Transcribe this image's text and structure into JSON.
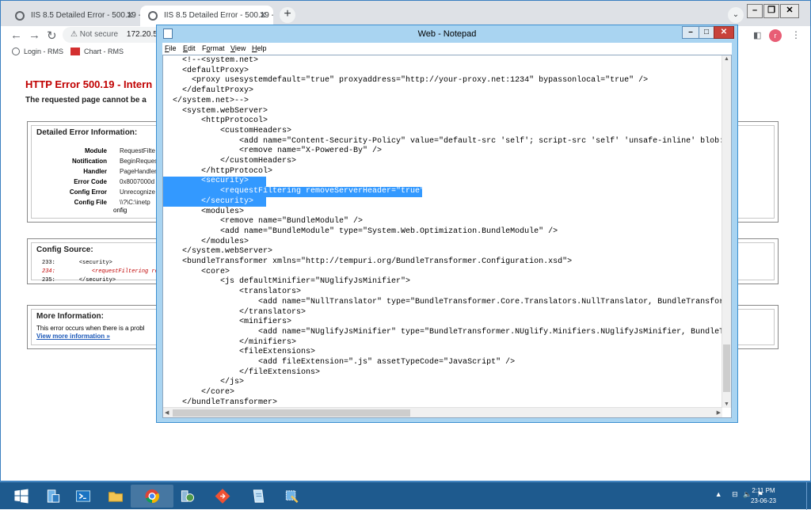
{
  "browser": {
    "tabs": [
      {
        "title": "IIS 8.5 Detailed Error - 500.19 - In"
      },
      {
        "title": "IIS 8.5 Detailed Error - 500.19 - In"
      }
    ],
    "new_tab_label": "+",
    "tab_search_icon": "chevron-down-icon",
    "security_label": "Not secure",
    "url": "172.20.5",
    "bookmarks": [
      {
        "label": "Login - RMS",
        "icon": "globe-icon"
      },
      {
        "label": "Chart - RMS",
        "icon": "rms-favicon"
      }
    ],
    "profile_initial": "r",
    "window_controls": [
      "minimize",
      "maximize",
      "close"
    ]
  },
  "iis": {
    "title": "HTTP Error 500.19 - Intern",
    "subtitle": "The requested page cannot be a",
    "detailed_heading": "Detailed Error Information:",
    "details": [
      {
        "label": "Module",
        "value": "RequestFilte"
      },
      {
        "label": "Notification",
        "value": "BeginReques"
      },
      {
        "label": "Handler",
        "value": "PageHandler"
      },
      {
        "label": "Error Code",
        "value": "0x8007000d"
      },
      {
        "label": "Config Error",
        "value": "Unrecognize"
      },
      {
        "label": "Config File",
        "value": "\\\\?\\C:\\inetp"
      }
    ],
    "config_file_extra": "onfig",
    "config_source_heading": "Config Source:",
    "config_source_lines": [
      {
        "num": "233:",
        "text": "<security>",
        "error": false
      },
      {
        "num": "234:",
        "text": "<requestFiltering re",
        "error": true
      },
      {
        "num": "235:",
        "text": "</security>",
        "error": false
      }
    ],
    "more_info_heading": "More Information:",
    "more_info_text": "This error occurs when there is a probl",
    "more_info_link": "View more information »"
  },
  "notepad": {
    "title": "Web - Notepad",
    "menu": [
      {
        "label": "File",
        "accel": "F",
        "rest": "ile"
      },
      {
        "label": "Edit",
        "accel": "E",
        "rest": "dit"
      },
      {
        "label": "Format",
        "accel": "o",
        "pre": "F",
        "rest": "rmat"
      },
      {
        "label": "View",
        "accel": "V",
        "rest": "iew"
      },
      {
        "label": "Help",
        "accel": "H",
        "rest": "elp"
      }
    ],
    "lines": [
      "    <!--<system.net>",
      "    <defaultProxy>",
      "      <proxy usesystemdefault=\"true\" proxyaddress=\"http://your-proxy.net:1234\" bypassonlocal=\"true\" />",
      "    </defaultProxy>",
      "  </system.net>-->",
      "    <system.webServer>",
      "        <httpProtocol>",
      "            <customHeaders>",
      "                <add name=\"Content-Security-Policy\" value=\"default-src 'self'; script-src 'self' 'unsafe-inline' blob:; style",
      "                <remove name=\"X-Powered-By\" />",
      "            </customHeaders>",
      "        </httpProtocol>",
      "        <security>",
      "            <requestFiltering removeServerHeader=\"true\" />",
      "        </security>",
      "        <modules>",
      "            <remove name=\"BundleModule\" />",
      "            <add name=\"BundleModule\" type=\"System.Web.Optimization.BundleModule\" />",
      "        </modules>",
      "    </system.webServer>",
      "    <bundleTransformer xmlns=\"http://tempuri.org/BundleTransformer.Configuration.xsd\">",
      "        <core>",
      "            <js defaultMinifier=\"NUglifyJsMinifier\">",
      "                <translators>",
      "                    <add name=\"NullTranslator\" type=\"BundleTransformer.Core.Translators.NullTranslator, BundleTransformer.Cor",
      "                </translators>",
      "                <minifiers>",
      "                    <add name=\"NUglifyJsMinifier\" type=\"BundleTransformer.NUglify.Minifiers.NUglifyJsMinifier, BundleTransfor",
      "                </minifiers>",
      "                <fileExtensions>",
      "                    <add fileExtension=\".js\" assetTypeCode=\"JavaScript\" />",
      "                </fileExtensions>",
      "            </js>",
      "        </core>",
      "    </bundleTransformer>"
    ],
    "selected_lines": [
      12,
      13,
      14
    ]
  },
  "taskbar": {
    "items": [
      {
        "name": "start-button",
        "icon": "windows-logo-icon"
      },
      {
        "name": "server-manager",
        "icon": "server-manager-icon"
      },
      {
        "name": "powershell",
        "icon": "powershell-icon"
      },
      {
        "name": "file-explorer",
        "icon": "folder-icon"
      },
      {
        "name": "chrome",
        "icon": "chrome-icon"
      },
      {
        "name": "iis-manager",
        "icon": "iis-manager-icon"
      },
      {
        "name": "git",
        "icon": "git-icon"
      },
      {
        "name": "notepad",
        "icon": "notepad-icon"
      },
      {
        "name": "tool",
        "icon": "tool-icon"
      }
    ],
    "time": "2:11 PM",
    "date": "23-06-23"
  },
  "colors": {
    "iis_error_red": "#c00000",
    "selection": "#3399ff",
    "notepad_frame": "#a9d4f1",
    "taskbar": "#1e5a8e"
  }
}
